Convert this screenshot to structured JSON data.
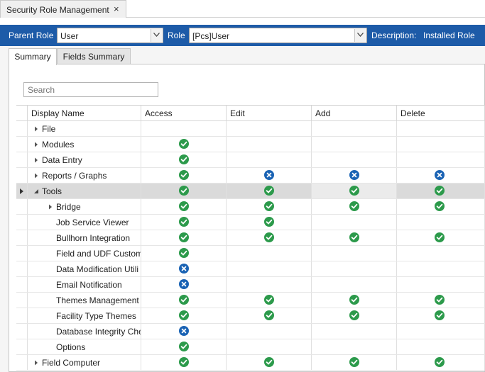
{
  "doc_tab": {
    "title": "Security Role Management",
    "close_glyph": "×"
  },
  "header": {
    "parent_role_label": "Parent Role",
    "parent_role_value": "User",
    "role_label": "Role",
    "role_value": "[Pcs]User",
    "description_label": "Description:",
    "description_value": "Installed Role",
    "bar_color": "#1d5ba8"
  },
  "tabs": [
    {
      "label": "Summary",
      "active": true
    },
    {
      "label": "Fields Summary",
      "active": false
    }
  ],
  "search": {
    "placeholder": "Search"
  },
  "grid": {
    "columns": [
      "Display Name",
      "Access",
      "Edit",
      "Add",
      "Delete"
    ],
    "rows": [
      {
        "name": "File",
        "level": 0,
        "expander": "collapsed",
        "access": "",
        "edit": "",
        "add": "",
        "delete": ""
      },
      {
        "name": "Modules",
        "level": 0,
        "expander": "collapsed",
        "access": "allow",
        "edit": "",
        "add": "",
        "delete": ""
      },
      {
        "name": "Data Entry",
        "level": 0,
        "expander": "collapsed",
        "access": "allow",
        "edit": "",
        "add": "",
        "delete": ""
      },
      {
        "name": "Reports / Graphs",
        "level": 0,
        "expander": "collapsed",
        "access": "allow",
        "edit": "deny",
        "add": "deny",
        "delete": "deny"
      },
      {
        "name": "Tools",
        "level": 0,
        "expander": "expanded",
        "selected": true,
        "access": "allow",
        "edit": "allow",
        "add": "allow",
        "delete": "allow"
      },
      {
        "name": "Bridge",
        "level": 1,
        "expander": "collapsed",
        "access": "allow",
        "edit": "allow",
        "add": "allow",
        "delete": "allow"
      },
      {
        "name": "Job Service Viewer",
        "level": 1,
        "expander": "none",
        "access": "allow",
        "edit": "allow",
        "add": "",
        "delete": ""
      },
      {
        "name": "Bullhorn Integration",
        "level": 1,
        "expander": "none",
        "access": "allow",
        "edit": "allow",
        "add": "allow",
        "delete": "allow"
      },
      {
        "name": "Field and UDF Custom",
        "level": 1,
        "expander": "none",
        "access": "allow",
        "edit": "",
        "add": "",
        "delete": ""
      },
      {
        "name": "Data Modification Utili",
        "level": 1,
        "expander": "none",
        "access": "deny",
        "edit": "",
        "add": "",
        "delete": ""
      },
      {
        "name": "Email Notification",
        "level": 1,
        "expander": "none",
        "access": "deny",
        "edit": "",
        "add": "",
        "delete": ""
      },
      {
        "name": "Themes Management",
        "level": 1,
        "expander": "none",
        "access": "allow",
        "edit": "allow",
        "add": "allow",
        "delete": "allow"
      },
      {
        "name": "Facility Type Themes",
        "level": 1,
        "expander": "none",
        "access": "allow",
        "edit": "allow",
        "add": "allow",
        "delete": "allow"
      },
      {
        "name": "Database Integrity Che",
        "level": 1,
        "expander": "none",
        "access": "deny",
        "edit": "",
        "add": "",
        "delete": ""
      },
      {
        "name": "Options",
        "level": 1,
        "expander": "none",
        "access": "allow",
        "edit": "",
        "add": "",
        "delete": ""
      },
      {
        "name": "Field Computer",
        "level": 0,
        "expander": "collapsed",
        "access": "allow",
        "edit": "allow",
        "add": "allow",
        "delete": "allow"
      }
    ]
  },
  "icons": {
    "allow": "check-circle-icon",
    "deny": "x-circle-icon",
    "allow_color": "#2c9a4b",
    "deny_color": "#1a63b4"
  }
}
